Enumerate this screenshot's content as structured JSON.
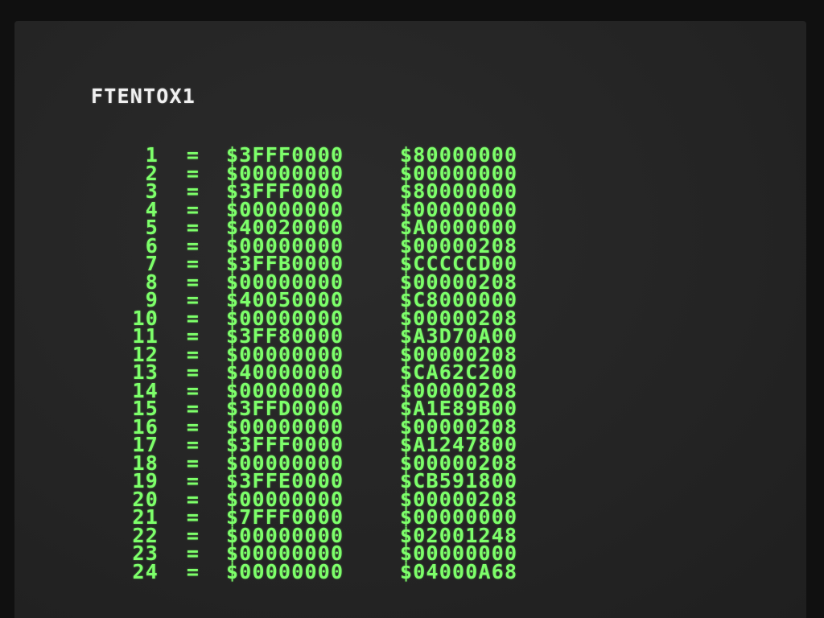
{
  "title": "FTENTOX1",
  "colors": {
    "text_green": "#7dff6a",
    "title_white": "#f0f0f0",
    "screen_bg": "#262626"
  },
  "rows": [
    {
      "n": "1",
      "eq": "=",
      "hi": "$3FFF0000",
      "lo": "$80000000"
    },
    {
      "n": "2",
      "eq": "=",
      "hi": "$00000000",
      "lo": "$00000000"
    },
    {
      "n": "3",
      "eq": "=",
      "hi": "$3FFF0000",
      "lo": "$80000000"
    },
    {
      "n": "4",
      "eq": "=",
      "hi": "$00000000",
      "lo": "$00000000"
    },
    {
      "n": "5",
      "eq": "=",
      "hi": "$40020000",
      "lo": "$A0000000"
    },
    {
      "n": "6",
      "eq": "=",
      "hi": "$00000000",
      "lo": "$00000208"
    },
    {
      "n": "7",
      "eq": "=",
      "hi": "$3FFB0000",
      "lo": "$CCCCCD00"
    },
    {
      "n": "8",
      "eq": "=",
      "hi": "$00000000",
      "lo": "$00000208"
    },
    {
      "n": "9",
      "eq": "=",
      "hi": "$40050000",
      "lo": "$C8000000"
    },
    {
      "n": "10",
      "eq": "=",
      "hi": "$00000000",
      "lo": "$00000208"
    },
    {
      "n": "11",
      "eq": "=",
      "hi": "$3FF80000",
      "lo": "$A3D70A00"
    },
    {
      "n": "12",
      "eq": "=",
      "hi": "$00000000",
      "lo": "$00000208"
    },
    {
      "n": "13",
      "eq": "=",
      "hi": "$40000000",
      "lo": "$CA62C200"
    },
    {
      "n": "14",
      "eq": "=",
      "hi": "$00000000",
      "lo": "$00000208"
    },
    {
      "n": "15",
      "eq": "=",
      "hi": "$3FFD0000",
      "lo": "$A1E89B00"
    },
    {
      "n": "16",
      "eq": "=",
      "hi": "$00000000",
      "lo": "$00000208"
    },
    {
      "n": "17",
      "eq": "=",
      "hi": "$3FFF0000",
      "lo": "$A1247800"
    },
    {
      "n": "18",
      "eq": "=",
      "hi": "$00000000",
      "lo": "$00000208"
    },
    {
      "n": "19",
      "eq": "=",
      "hi": "$3FFE0000",
      "lo": "$CB591800"
    },
    {
      "n": "20",
      "eq": "=",
      "hi": "$00000000",
      "lo": "$00000208"
    },
    {
      "n": "21",
      "eq": "=",
      "hi": "$7FFF0000",
      "lo": "$00000000"
    },
    {
      "n": "22",
      "eq": "=",
      "hi": "$00000000",
      "lo": "$02001248"
    },
    {
      "n": "23",
      "eq": "=",
      "hi": "$00000000",
      "lo": "$00000000"
    },
    {
      "n": "24",
      "eq": "=",
      "hi": "$00000000",
      "lo": "$04000A68"
    }
  ]
}
